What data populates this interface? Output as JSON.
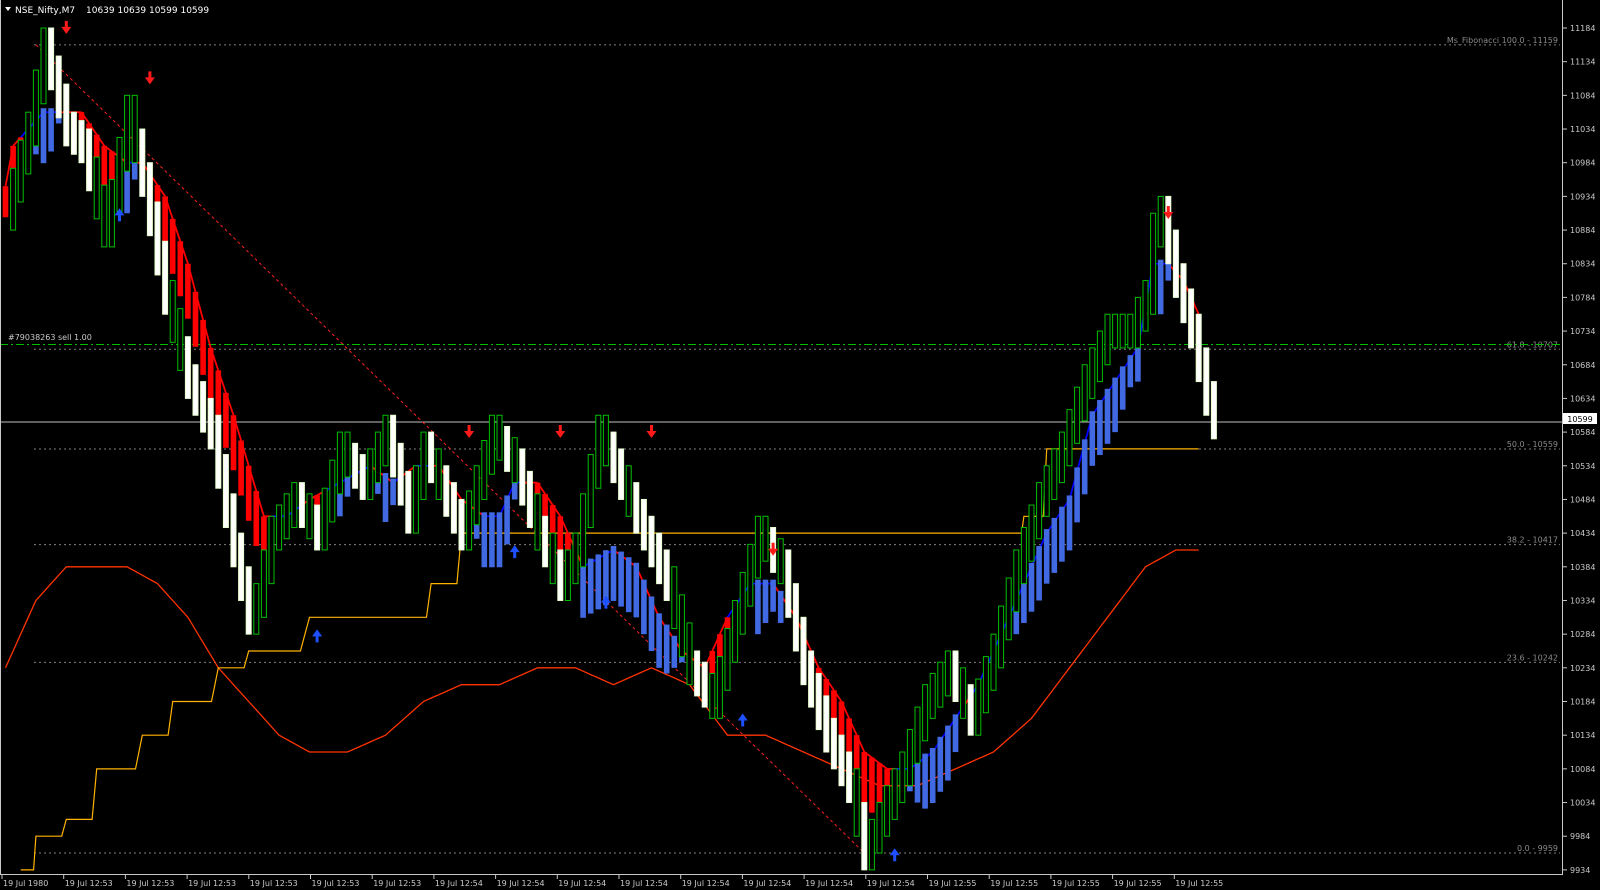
{
  "header": {
    "symbol": "NSE_Nifty,M7",
    "ohlc": "10639 10639 10599 10599"
  },
  "order_label": "#79038263 sell 1.00",
  "current_price": "10599",
  "colors": {
    "background": "#000000",
    "bull_candle": "#00c000",
    "bear_candle": "#ffffff",
    "renko_up": "#4169e1",
    "renko_down": "#ff0000",
    "signal_line_up": "#0000ff",
    "signal_line_down": "#ff0000",
    "moving_average": "#ff3300",
    "stepped_line": "#ffb300",
    "fib_levels": "#808080",
    "order_line": "#00c000",
    "price_line": "#c0c0c0"
  },
  "chart_data": {
    "type": "candlestick",
    "ylim": [
      9922,
      11196
    ],
    "y_ticks": [
      "11184",
      "11134",
      "11084",
      "11034",
      "10984",
      "10934",
      "10884",
      "10834",
      "10784",
      "10734",
      "10684",
      "10634",
      "10584",
      "10534",
      "10484",
      "10434",
      "10384",
      "10334",
      "10284",
      "10234",
      "10184",
      "10134",
      "10084",
      "10034",
      "9984",
      "9934"
    ],
    "x_ticks": [
      "19 Jul 1980",
      "19 Jul 12:53",
      "19 Jul 12:53",
      "19 Jul 12:53",
      "19 Jul 12:53",
      "19 Jul 12:53",
      "19 Jul 12:53",
      "19 Jul 12:54",
      "19 Jul 12:54",
      "19 Jul 12:54",
      "19 Jul 12:54",
      "19 Jul 12:54",
      "19 Jul 12:54",
      "19 Jul 12:54",
      "19 Jul 12:54",
      "19 Jul 12:55",
      "19 Jul 12:55",
      "19 Jul 12:55",
      "19 Jul 12:55",
      "19 Jul 12:55"
    ],
    "fibonacci": {
      "name": "Ms_Fibonacci",
      "levels": [
        {
          "label": "100.0 - 11159",
          "value": 11159
        },
        {
          "label": "61.8 - 10707",
          "value": 10707
        },
        {
          "label": "50.0 - 10559",
          "value": 10559
        },
        {
          "label": "38.2 - 10417",
          "value": 10417
        },
        {
          "label": "23.6 - 10242",
          "value": 10242
        },
        {
          "label": "0.0 - 9959",
          "value": 9959
        }
      ]
    },
    "order_line_value": 10714,
    "current_price_value": 10599,
    "close_waypoints": [
      [
        0,
        10909
      ],
      [
        3,
        11034
      ],
      [
        5,
        11159
      ],
      [
        8,
        11034
      ],
      [
        10,
        11009
      ],
      [
        13,
        10884
      ],
      [
        14,
        10934
      ],
      [
        16,
        11059
      ],
      [
        18,
        10959
      ],
      [
        21,
        10784
      ],
      [
        24,
        10659
      ],
      [
        27,
        10584
      ],
      [
        30,
        10409
      ],
      [
        32,
        10309
      ],
      [
        33,
        10334
      ],
      [
        35,
        10434
      ],
      [
        38,
        10484
      ],
      [
        41,
        10434
      ],
      [
        44,
        10559
      ],
      [
        47,
        10509
      ],
      [
        50,
        10584
      ],
      [
        53,
        10459
      ],
      [
        55,
        10559
      ],
      [
        58,
        10484
      ],
      [
        60,
        10434
      ],
      [
        64,
        10584
      ],
      [
        67,
        10534
      ],
      [
        70,
        10434
      ],
      [
        73,
        10359
      ],
      [
        75,
        10409
      ],
      [
        78,
        10584
      ],
      [
        81,
        10509
      ],
      [
        84,
        10434
      ],
      [
        87,
        10359
      ],
      [
        90,
        10234
      ],
      [
        93,
        10184
      ],
      [
        96,
        10309
      ],
      [
        99,
        10434
      ],
      [
        102,
        10384
      ],
      [
        105,
        10234
      ],
      [
        108,
        10134
      ],
      [
        111,
        10059
      ],
      [
        113,
        9959
      ],
      [
        115,
        10009
      ],
      [
        118,
        10084
      ],
      [
        121,
        10184
      ],
      [
        124,
        10234
      ],
      [
        127,
        10159
      ],
      [
        130,
        10259
      ],
      [
        133,
        10384
      ],
      [
        136,
        10484
      ],
      [
        139,
        10559
      ],
      [
        142,
        10659
      ],
      [
        145,
        10734
      ],
      [
        148,
        10734
      ],
      [
        150,
        10784
      ],
      [
        151,
        10884
      ],
      [
        152,
        10909
      ],
      [
        154,
        10809
      ],
      [
        156,
        10734
      ],
      [
        158,
        10634
      ],
      [
        159,
        10599
      ]
    ],
    "signal_line_waypoints": [
      [
        0,
        10949
      ],
      [
        1,
        11009
      ],
      [
        5,
        11059
      ],
      [
        10,
        11059
      ],
      [
        13,
        11009
      ],
      [
        16,
        10984
      ],
      [
        18,
        10984
      ],
      [
        21,
        10934
      ],
      [
        24,
        10834
      ],
      [
        27,
        10709
      ],
      [
        30,
        10609
      ],
      [
        32,
        10534
      ],
      [
        34,
        10459
      ],
      [
        37,
        10459
      ],
      [
        40,
        10484
      ],
      [
        44,
        10509
      ],
      [
        48,
        10534
      ],
      [
        51,
        10509
      ],
      [
        54,
        10534
      ],
      [
        57,
        10534
      ],
      [
        60,
        10484
      ],
      [
        63,
        10459
      ],
      [
        65,
        10459
      ],
      [
        67,
        10509
      ],
      [
        70,
        10509
      ],
      [
        73,
        10459
      ],
      [
        76,
        10384
      ],
      [
        80,
        10409
      ],
      [
        83,
        10384
      ],
      [
        86,
        10309
      ],
      [
        89,
        10259
      ],
      [
        92,
        10234
      ],
      [
        95,
        10309
      ],
      [
        98,
        10359
      ],
      [
        101,
        10359
      ],
      [
        104,
        10309
      ],
      [
        107,
        10234
      ],
      [
        110,
        10184
      ],
      [
        113,
        10109
      ],
      [
        116,
        10084
      ],
      [
        119,
        10084
      ],
      [
        122,
        10109
      ],
      [
        125,
        10159
      ],
      [
        128,
        10209
      ],
      [
        131,
        10284
      ],
      [
        134,
        10359
      ],
      [
        137,
        10434
      ],
      [
        140,
        10484
      ],
      [
        143,
        10609
      ],
      [
        146,
        10659
      ],
      [
        149,
        10709
      ],
      [
        151,
        10834
      ],
      [
        153,
        10834
      ],
      [
        155,
        10809
      ],
      [
        157,
        10759
      ]
    ],
    "moving_average_waypoints": [
      [
        0,
        10234
      ],
      [
        4,
        10334
      ],
      [
        8,
        10384
      ],
      [
        12,
        10384
      ],
      [
        16,
        10384
      ],
      [
        20,
        10359
      ],
      [
        24,
        10309
      ],
      [
        28,
        10234
      ],
      [
        32,
        10184
      ],
      [
        36,
        10134
      ],
      [
        40,
        10109
      ],
      [
        45,
        10109
      ],
      [
        50,
        10134
      ],
      [
        55,
        10184
      ],
      [
        60,
        10209
      ],
      [
        65,
        10209
      ],
      [
        70,
        10234
      ],
      [
        75,
        10234
      ],
      [
        80,
        10209
      ],
      [
        85,
        10234
      ],
      [
        90,
        10209
      ],
      [
        95,
        10134
      ],
      [
        100,
        10134
      ],
      [
        105,
        10109
      ],
      [
        110,
        10084
      ],
      [
        115,
        10059
      ],
      [
        120,
        10059
      ],
      [
        125,
        10084
      ],
      [
        130,
        10109
      ],
      [
        135,
        10159
      ],
      [
        140,
        10234
      ],
      [
        145,
        10309
      ],
      [
        150,
        10384
      ],
      [
        154,
        10409
      ],
      [
        157,
        10409
      ]
    ],
    "stepped_line_waypoints": [
      [
        2,
        9934
      ],
      [
        4,
        9984
      ],
      [
        8,
        10009
      ],
      [
        12,
        10084
      ],
      [
        18,
        10134
      ],
      [
        22,
        10184
      ],
      [
        28,
        10234
      ],
      [
        32,
        10259
      ],
      [
        40,
        10309
      ],
      [
        52,
        10309
      ],
      [
        56,
        10359
      ],
      [
        60,
        10434
      ],
      [
        70,
        10434
      ],
      [
        90,
        10434
      ],
      [
        110,
        10434
      ],
      [
        120,
        10434
      ],
      [
        132,
        10434
      ],
      [
        134,
        10459
      ],
      [
        137,
        10559
      ],
      [
        157,
        10559
      ]
    ],
    "arrows_down": [
      [
        8,
        11159
      ],
      [
        19,
        11084
      ],
      [
        61,
        10559
      ],
      [
        73,
        10559
      ],
      [
        85,
        10559
      ],
      [
        101,
        10384
      ],
      [
        153,
        10884
      ]
    ],
    "arrows_up": [
      [
        15,
        10934
      ],
      [
        41,
        10309
      ],
      [
        67,
        10434
      ],
      [
        79,
        10359
      ],
      [
        97,
        10184
      ],
      [
        117,
        9984
      ]
    ],
    "diagonal_line": [
      [
        4,
        11159
      ],
      [
        113,
        9959
      ]
    ],
    "bull_candles": [
      2,
      3,
      4,
      5,
      12,
      13,
      14,
      16,
      17,
      22,
      23,
      34,
      35,
      38,
      40,
      44,
      45,
      48,
      50,
      55,
      57,
      64,
      65,
      67,
      70,
      72,
      75,
      77,
      79,
      82,
      88,
      89,
      90,
      93,
      95,
      96,
      98,
      100,
      102,
      112,
      114,
      115,
      116,
      118,
      120,
      123,
      124,
      126,
      128,
      130,
      131,
      133,
      134,
      136,
      138,
      140,
      141,
      142,
      143,
      144,
      145,
      146,
      147,
      148,
      149,
      150,
      151
    ]
  }
}
